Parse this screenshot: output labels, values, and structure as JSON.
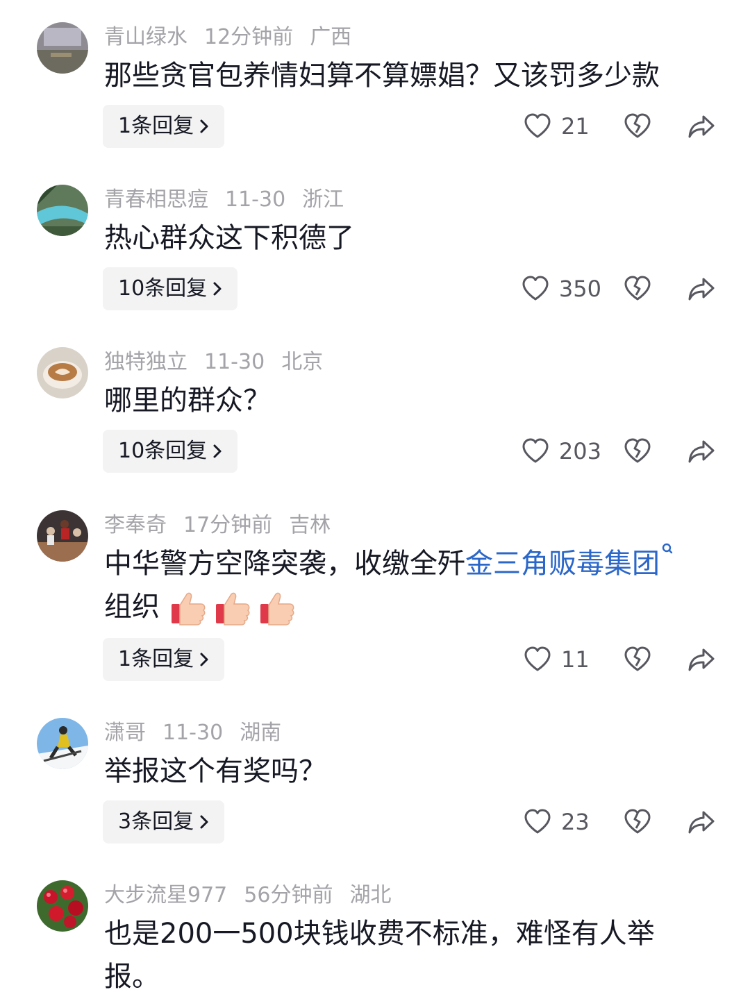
{
  "comments": [
    {
      "username": "青山绿水",
      "time": "12分钟前",
      "location": "广西",
      "text_lines": [
        "那些贪官包养情妇算不算嫖娼？又该罚多少款"
      ],
      "replies_label": "1条回复",
      "likes": "21"
    },
    {
      "username": "青春相思痘",
      "time": "11-30",
      "location": "浙江",
      "text_lines": [
        "热心群众这下积德了"
      ],
      "replies_label": "10条回复",
      "likes": "350"
    },
    {
      "username": "独特独立",
      "time": "11-30",
      "location": "北京",
      "text_lines": [
        "哪里的群众？"
      ],
      "replies_label": "10条回复",
      "likes": "203"
    },
    {
      "username": "李奉奇",
      "time": "17分钟前",
      "location": "吉林",
      "text_prefix": "中华警方空降突袭，收缴全歼",
      "text_link": "金三角贩毒集团",
      "text_line2": "组织",
      "replies_label": "1条回复",
      "likes": "11"
    },
    {
      "username": "潇哥",
      "time": "11-30",
      "location": "湖南",
      "text_lines": [
        "举报这个有奖吗？"
      ],
      "replies_label": "3条回复",
      "likes": "23"
    },
    {
      "username": "大步流星977",
      "time": "56分钟前",
      "location": "湖北",
      "text_lines": [
        "也是200一500块钱收费不标准，难怪有人举",
        "报。"
      ]
    }
  ],
  "icons": {
    "like": "heart-outline-icon",
    "dislike": "broken-heart-icon",
    "share": "share-arrow-icon",
    "reply_chevron": "chevron-right-icon",
    "search": "search-icon",
    "thumbs_up": "thumbs-up-emoji"
  },
  "colors": {
    "text": "#161823",
    "meta": "#a3a3a8",
    "link": "#2b67c9",
    "reply_bg": "#f3f3f4"
  }
}
